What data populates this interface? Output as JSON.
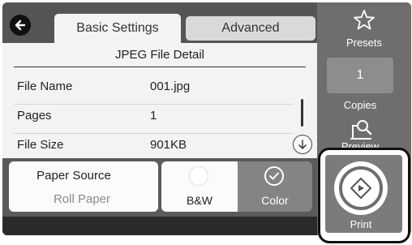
{
  "tabs": {
    "basic_label": "Basic Settings",
    "advanced_label": "Advanced"
  },
  "section": {
    "title": "JPEG File Detail"
  },
  "file_details": [
    {
      "label": "File Name",
      "value": "001.jpg"
    },
    {
      "label": "Pages",
      "value": "1"
    },
    {
      "label": "File Size",
      "value": "901KB"
    }
  ],
  "paper_source": {
    "title": "Paper Source",
    "value": "Roll Paper"
  },
  "color_mode": {
    "bw_label": "B&W",
    "color_label": "Color",
    "selected": "Color"
  },
  "side_panel": {
    "presets_label": "Presets",
    "copies_value": "1",
    "copies_label": "Copies",
    "preview_label": "Preview",
    "print_label": "Print"
  },
  "icons": {
    "back": "back-arrow-icon",
    "presets": "star-icon",
    "preview": "magnifier-document-icon",
    "print": "print-diamond-icon",
    "scroll": "arrow-down-circle-icon",
    "selected": "check-circle-icon"
  },
  "colors": {
    "accent_dark": "#555555",
    "side_panel": "#6e6e6e",
    "selected_option": "#848484"
  }
}
